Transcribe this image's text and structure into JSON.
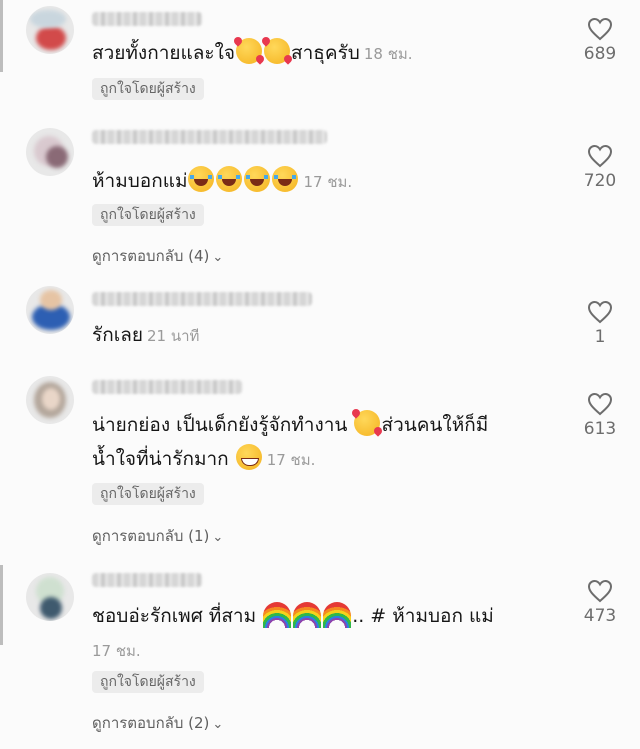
{
  "comments": [
    {
      "text": "สวยทั้งกายและใจ",
      "text2": "สาธุครับ",
      "time": "18 ชม.",
      "liked_by_creator": "ถูกใจโดยผู้สร้าง",
      "likes": "689"
    },
    {
      "text": "ห้ามบอกแม่",
      "time": "17 ชม.",
      "liked_by_creator": "ถูกใจโดยผู้สร้าง",
      "replies": "ดูการตอบกลับ (4)",
      "likes": "720"
    },
    {
      "text": "รักเลย",
      "time": "21 นาที",
      "likes": "1"
    },
    {
      "text": "น่ายกย่อง เป็นเด็กยังรู้จักทำงาน",
      "text2": "ส่วนคนให้ก็มี",
      "text3": "น้ำใจที่น่ารักมาก",
      "time": "17 ชม.",
      "liked_by_creator": "ถูกใจโดยผู้สร้าง",
      "replies": "ดูการตอบกลับ (1)",
      "likes": "613"
    },
    {
      "text": "ชอบอ่ะรักเพศ ที่สาม",
      "text2": ".. # ห้ามบอก แม่",
      "time": "17 ชม.",
      "liked_by_creator": "ถูกใจโดยผู้สร้าง",
      "replies": "ดูการตอบกลับ (2)",
      "likes": "473"
    }
  ],
  "icons": {
    "like": "heart-outline-icon",
    "chevron": "chevron-down-icon",
    "emoji_love": "smiling-face-with-hearts",
    "emoji_laugh": "face-with-tears-of-joy",
    "emoji_grin": "grinning-face",
    "emoji_rainbow": "rainbow"
  },
  "colors": {
    "background": "#fbfbfb",
    "chip_bg": "#ececec",
    "muted": "#9a9a9a"
  }
}
